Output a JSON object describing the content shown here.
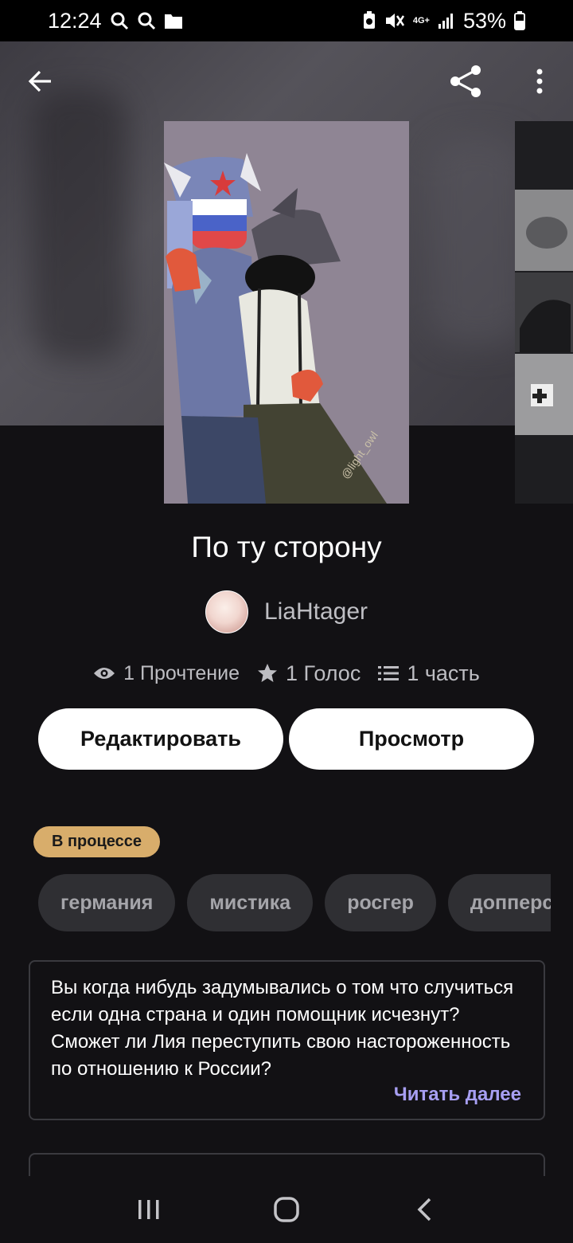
{
  "status_bar": {
    "time": "12:24",
    "battery": "53%",
    "network": "4G+"
  },
  "toolbar": {
    "back_icon": "arrow-left-icon",
    "share_icon": "share-icon",
    "more_icon": "more-vertical-icon"
  },
  "story": {
    "title": "По ту сторону",
    "author": "LiaHtager",
    "stats": {
      "reads": "1 Прочтение",
      "votes": "1 Голос",
      "parts": "1 часть"
    },
    "buttons": {
      "edit": "Редактировать",
      "view": "Просмотр"
    },
    "status": "В процессе",
    "tags": [
      "германия",
      "мистика",
      "росгер",
      "допперсонаж"
    ],
    "description": "Вы когда нибудь задумывались о том что случиться если одна страна и один помощник исчезнут? Сможет ли Лия переступить свою настороженность по отношению к России?",
    "read_more": "Читать далее"
  },
  "colors": {
    "background": "#121114",
    "accent_purple": "#a79ff2",
    "status_chip": "#d8ad6b",
    "tag_bg": "#2f2f33"
  }
}
